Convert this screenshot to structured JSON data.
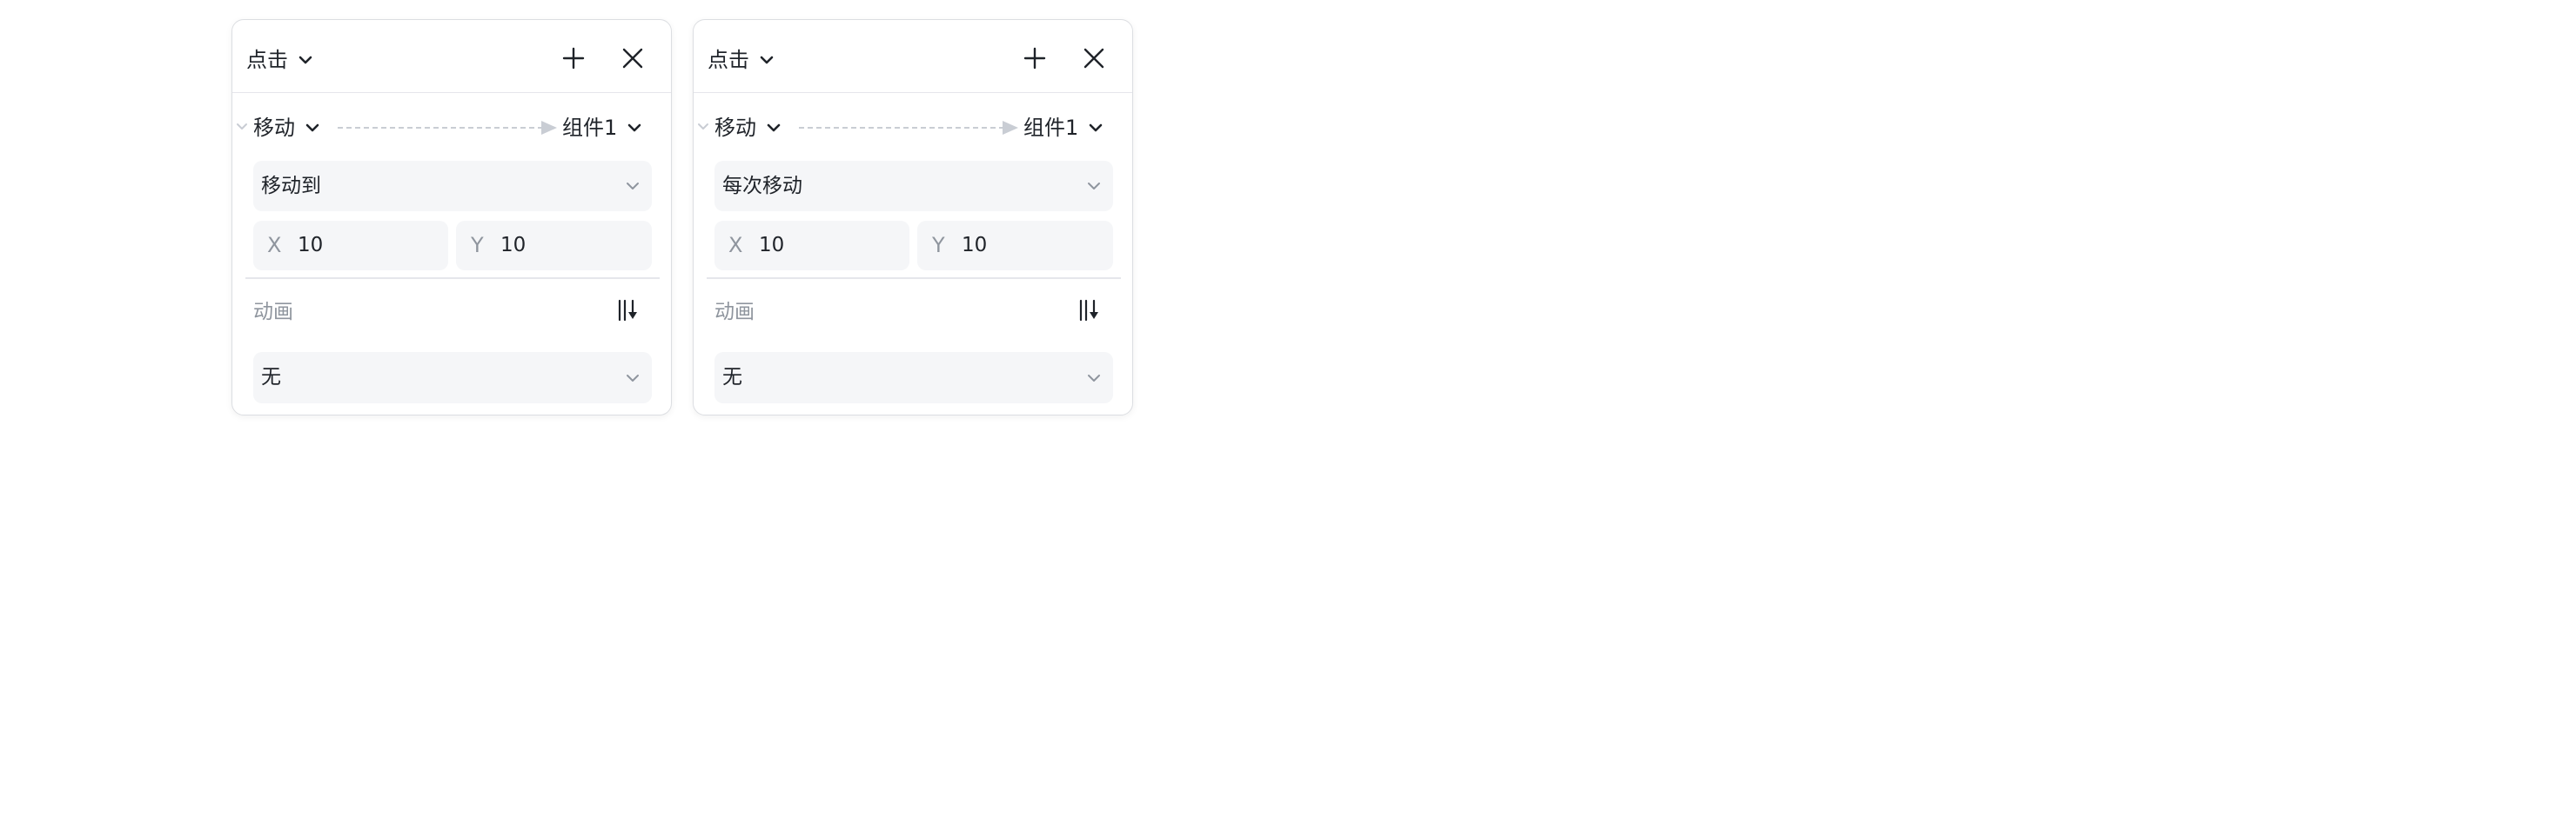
{
  "panels": [
    {
      "trigger": "点击",
      "action": "移动",
      "target": "组件1",
      "move_mode": "移动到",
      "x_label": "X",
      "x_value": "10",
      "y_label": "Y",
      "y_value": "10",
      "animation_label": "动画",
      "animation_value": "无"
    },
    {
      "trigger": "点击",
      "action": "移动",
      "target": "组件1",
      "move_mode": "每次移动",
      "x_label": "X",
      "x_value": "10",
      "y_label": "Y",
      "y_value": "10",
      "animation_label": "动画",
      "animation_value": "无"
    }
  ],
  "icons": {
    "trigger_dropdown": "chevron-down-icon",
    "add": "plus-icon",
    "close": "close-icon",
    "collapse": "chevron-down-icon",
    "arrow": "dashed-arrow-icon",
    "settings": "animation-settings-icon"
  },
  "colors": {
    "text": "#1f2329",
    "muted": "#8f959e",
    "field_bg": "#f5f6f8",
    "border": "#e5e6eb",
    "arrow": "#c9cdd4"
  }
}
